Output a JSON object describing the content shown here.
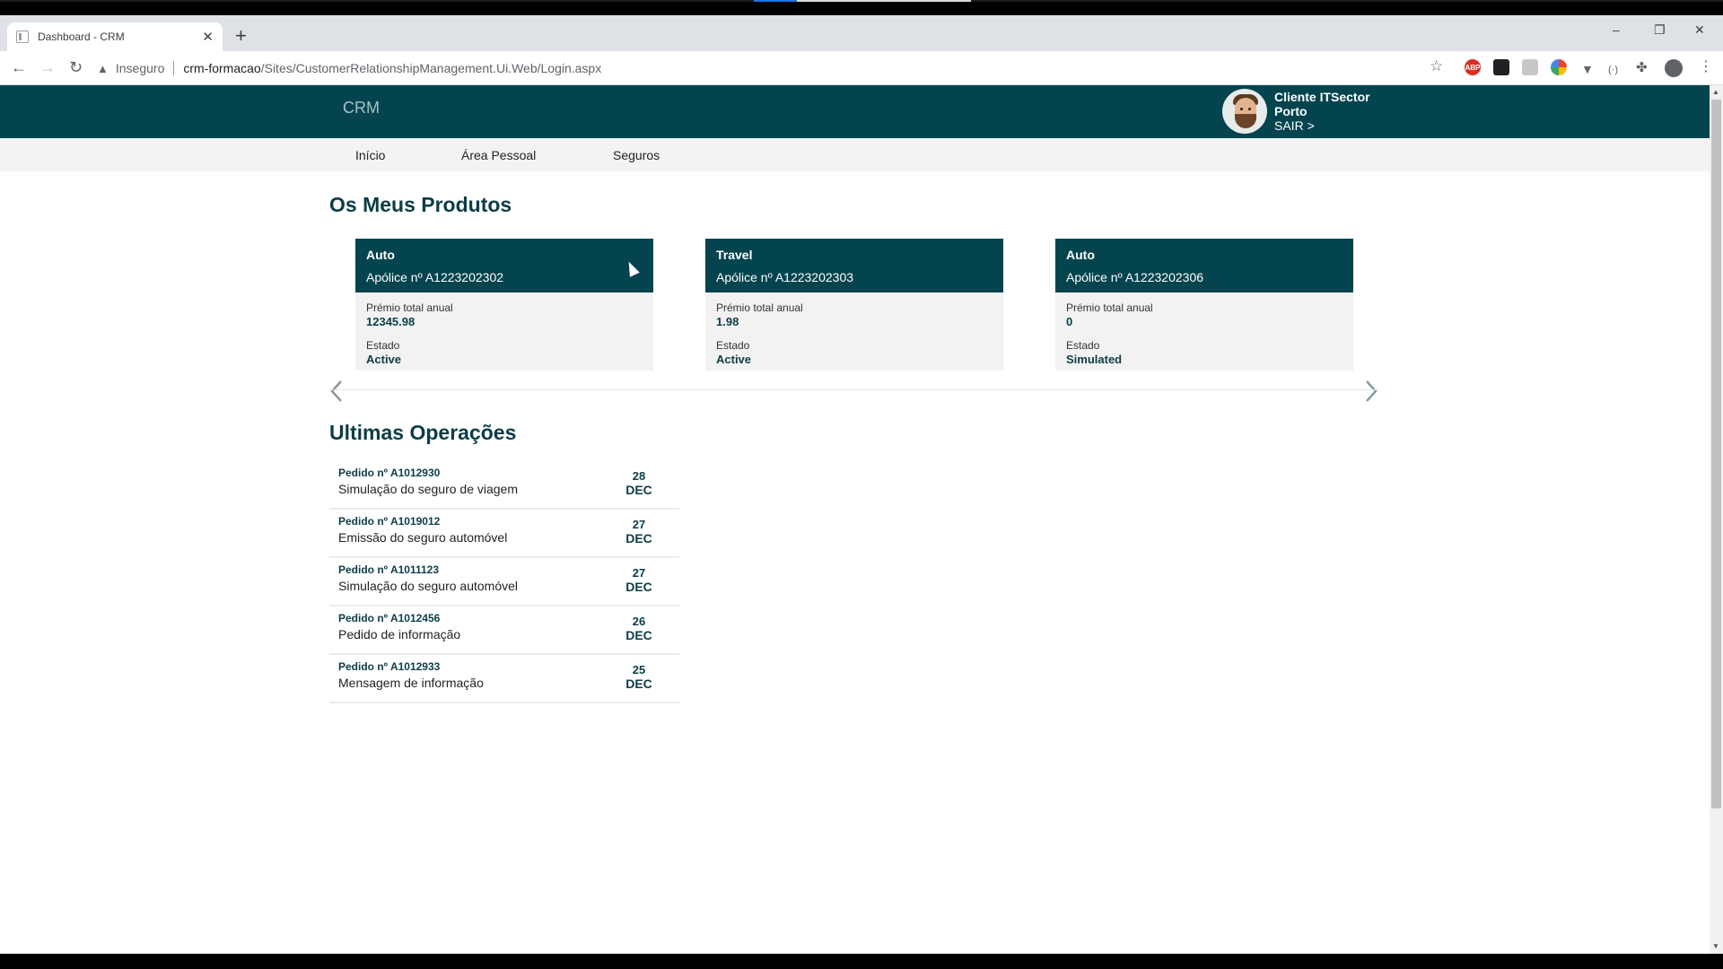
{
  "browser": {
    "tab_title": "Dashboard - CRM",
    "new_tab": "+",
    "tab_close": "✕",
    "security_label": "Inseguro",
    "url_host": "crm-formacao",
    "url_path": "/Sites/CustomerRelationshipManagement.Ui.Web/Login.aspx",
    "window_controls": [
      "–",
      "❐",
      "✕"
    ]
  },
  "header": {
    "brand": "CRM",
    "user_name": "Cliente ITSector",
    "user_city": "Porto",
    "logout": "SAIR >"
  },
  "menu": {
    "items": [
      "Início",
      "Área Pessoal",
      "Seguros"
    ]
  },
  "products": {
    "title": "Os Meus Produtos",
    "premium_label": "Prémio total anual",
    "status_label": "Estado",
    "cards": [
      {
        "category": "Auto",
        "policy": "Apólice nº A1223202302",
        "premium": "12345.98",
        "status": "Active"
      },
      {
        "category": "Travel",
        "policy": "Apólice nº A1223202303",
        "premium": "1.98",
        "status": "Active"
      },
      {
        "category": "Auto",
        "policy": "Apólice nº A1223202306",
        "premium": "0",
        "status": "Simulated"
      }
    ]
  },
  "operations": {
    "title": "Ultimas Operações",
    "items": [
      {
        "number": "Pedido nº A1012930",
        "description": "Simulação do seguro de viagem",
        "day": "28",
        "month": "DEC"
      },
      {
        "number": "Pedido nº A1019012",
        "description": "Emissão do seguro automóvel",
        "day": "27",
        "month": "DEC"
      },
      {
        "number": "Pedido nº A1011123",
        "description": "Simulação do seguro automóvel",
        "day": "27",
        "month": "DEC"
      },
      {
        "number": "Pedido nº A1012456",
        "description": "Pedido de informação",
        "day": "26",
        "month": "DEC"
      },
      {
        "number": "Pedido nº A1012933",
        "description": "Mensagem de informação",
        "day": "25",
        "month": "DEC"
      }
    ]
  },
  "colors": {
    "brand_dark": "#03444f",
    "menu_bg": "#f3f3f3",
    "card_bg": "#f2f2f2"
  },
  "icons": {
    "back": "arrow-left-icon",
    "forward": "arrow-right-icon",
    "reload": "reload-icon",
    "warning": "warning-icon",
    "star": "star-icon",
    "extensions": "puzzle-icon",
    "prev": "chevron-left-icon",
    "next": "chevron-right-icon"
  }
}
